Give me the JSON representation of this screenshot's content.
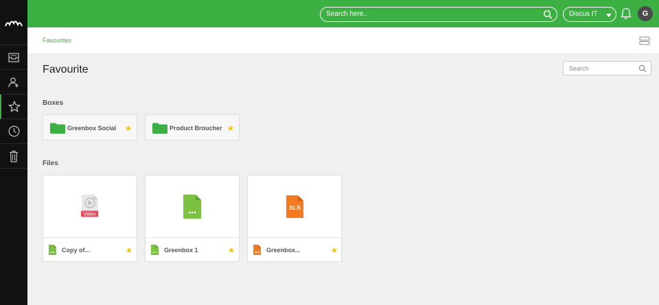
{
  "colors": {
    "brand": "#3cb043",
    "sidebar": "#111111",
    "star": "#f5c518",
    "xls": "#f47920",
    "video_badge": "#e5495c"
  },
  "topbar": {
    "search_placeholder": "Search here..",
    "company": "Discus IT",
    "avatar_initial": "G"
  },
  "sidebar": {
    "items": [
      {
        "icon": "inbox-icon"
      },
      {
        "icon": "add-user-icon"
      },
      {
        "icon": "star-icon",
        "active": true
      },
      {
        "icon": "clock-icon"
      },
      {
        "icon": "trash-icon"
      }
    ]
  },
  "breadcrumb": {
    "current": "Favourites"
  },
  "page": {
    "title": "Favourite",
    "search_placeholder": "Search"
  },
  "boxes": {
    "label": "Boxes",
    "items": [
      {
        "name": "Greenbox Social",
        "starred": true
      },
      {
        "name": "Product Broucher",
        "starred": true
      }
    ]
  },
  "files": {
    "label": "Files",
    "items": [
      {
        "name": "Copy of...",
        "type": "video",
        "badge": "Video",
        "starred": true
      },
      {
        "name": "Greenbox 1",
        "type": "doc",
        "starred": true
      },
      {
        "name": "Greenbox...",
        "type": "xls",
        "badge": "XLS",
        "footer_badge": "XLS",
        "starred": true
      }
    ]
  }
}
